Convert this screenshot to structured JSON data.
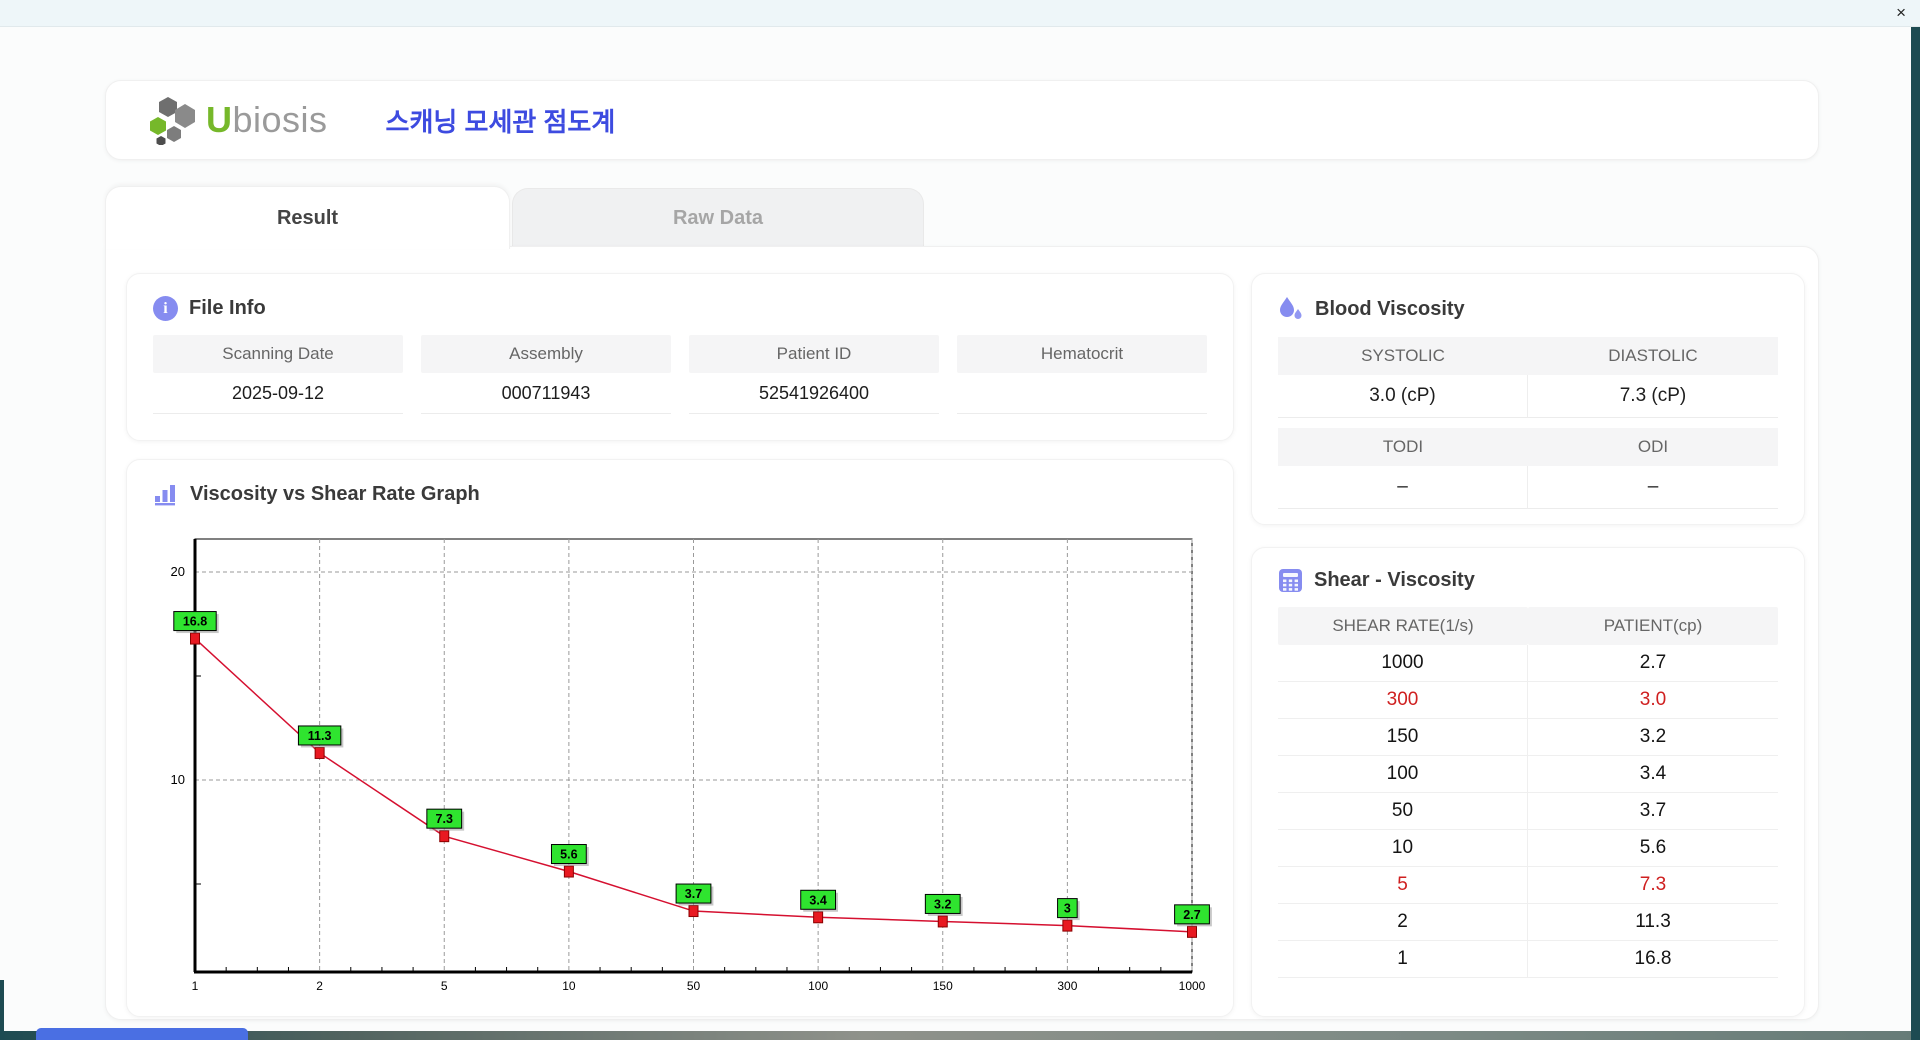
{
  "window": {
    "close_icon": "×"
  },
  "header": {
    "brand_u": "U",
    "brand_rest": "biosis",
    "title_ko": "스캐닝 모세관 점도계"
  },
  "tabs": [
    {
      "label": "Result",
      "active": true
    },
    {
      "label": "Raw Data",
      "active": false
    }
  ],
  "file_info": {
    "title": "File Info",
    "info_icon_glyph": "i",
    "fields": [
      {
        "label": "Scanning Date",
        "value": "2025-09-12"
      },
      {
        "label": "Assembly",
        "value": "000711943"
      },
      {
        "label": "Patient ID",
        "value": "52541926400"
      },
      {
        "label": "Hematocrit",
        "value": ""
      }
    ]
  },
  "graph": {
    "title": "Viscosity vs Shear Rate Graph"
  },
  "chart_data": {
    "type": "line",
    "title": "Viscosity vs Shear Rate Graph",
    "x": [
      1,
      2,
      5,
      10,
      50,
      100,
      150,
      300,
      1000
    ],
    "x_ticks": [
      "1",
      "2",
      "5",
      "10",
      "50",
      "100",
      "150",
      "300",
      "1000"
    ],
    "values": [
      16.8,
      11.3,
      7.3,
      5.6,
      3.7,
      3.4,
      3.2,
      3.0,
      2.7
    ],
    "point_labels": [
      "16.8",
      "11.3",
      "7.3",
      "5.6",
      "3.7",
      "3.4",
      "3.2",
      "3",
      "2.7"
    ],
    "xlabel": "",
    "ylabel": "",
    "y_ticks": [
      10,
      20
    ],
    "ylim": [
      0.77,
      21.6
    ],
    "x_axis_type": "categorical (log-like shear rates)",
    "grid": true,
    "legend": "none",
    "line_color": "#d51030",
    "marker_color": "#e81921",
    "marker_border": "#8a0000",
    "label_bg": "#2fe42f",
    "label_border": "#000000"
  },
  "blood_viscosity": {
    "title": "Blood Viscosity",
    "pairs": [
      {
        "labels": [
          "SYSTOLIC",
          "DIASTOLIC"
        ],
        "values": [
          "3.0 (cP)",
          "7.3 (cP)"
        ]
      },
      {
        "labels": [
          "TODI",
          "ODI"
        ],
        "values": [
          "–",
          "–"
        ]
      }
    ]
  },
  "shear_viscosity": {
    "title": "Shear - Viscosity",
    "columns": [
      "SHEAR RATE(1/s)",
      "PATIENT(cp)"
    ],
    "rows": [
      {
        "shear": "1000",
        "patient": "2.7",
        "highlight": false
      },
      {
        "shear": "300",
        "patient": "3.0",
        "highlight": true
      },
      {
        "shear": "150",
        "patient": "3.2",
        "highlight": false
      },
      {
        "shear": "100",
        "patient": "3.4",
        "highlight": false
      },
      {
        "shear": "50",
        "patient": "3.7",
        "highlight": false
      },
      {
        "shear": "10",
        "patient": "5.6",
        "highlight": false
      },
      {
        "shear": "5",
        "patient": "7.3",
        "highlight": true
      },
      {
        "shear": "2",
        "patient": "11.3",
        "highlight": false
      },
      {
        "shear": "1",
        "patient": "16.8",
        "highlight": false
      }
    ]
  },
  "colors": {
    "frame": "#1d4b52",
    "accent_purple": "#868cf0",
    "brand_green": "#76b82a",
    "title_blue": "#3d4be0",
    "highlight_red": "#cf1f1f",
    "taskbar_blue": "#4a6fe3"
  }
}
